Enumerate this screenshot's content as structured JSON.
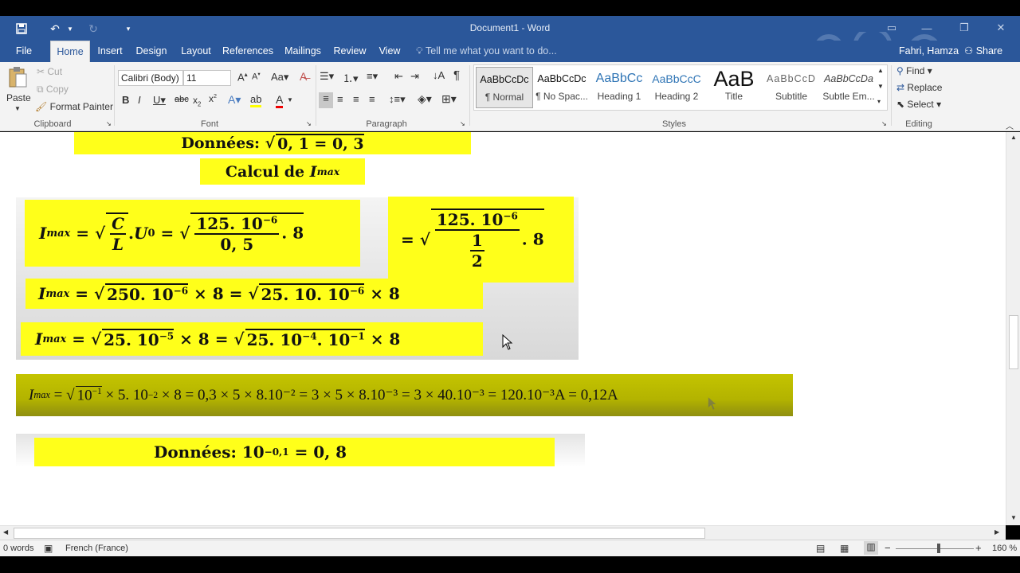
{
  "window": {
    "title": "Document1 - Word"
  },
  "tabs": [
    "File",
    "Home",
    "Insert",
    "Design",
    "Layout",
    "References",
    "Mailings",
    "Review",
    "View"
  ],
  "tell_me": "Tell me what you want to do...",
  "user_name": "Fahri, Hamza",
  "share_label": "Share",
  "clipboard": {
    "paste": "Paste",
    "cut": "Cut",
    "copy": "Copy",
    "format_painter": "Format Painter",
    "label": "Clipboard"
  },
  "font": {
    "name": "Calibri (Body)",
    "size": "11",
    "label": "Font"
  },
  "paragraph": {
    "label": "Paragraph"
  },
  "styles": {
    "label": "Styles",
    "items": [
      {
        "preview": "AaBbCcDc",
        "name": "¶ Normal"
      },
      {
        "preview": "AaBbCcDc",
        "name": "¶ No Spac..."
      },
      {
        "preview": "AaBbCc",
        "name": "Heading 1"
      },
      {
        "preview": "AaBbCcC",
        "name": "Heading 2"
      },
      {
        "preview": "AaB",
        "name": "Title"
      },
      {
        "preview": "AaBbCcD",
        "name": "Subtitle"
      },
      {
        "preview": "AaBbCcDa",
        "name": "Subtle Em..."
      }
    ]
  },
  "editing": {
    "find": "Find",
    "replace": "Replace",
    "select": "Select",
    "label": "Editing"
  },
  "document": {
    "eq1_text": "Données:",
    "eq1_math": "0, 1 = 0, 3",
    "eq2_text": "Calcul de",
    "eq2_var": "I",
    "eq2_sub": "max",
    "eq7_text": "Données:",
    "eq7_math": "= 0, 8",
    "eq6_text": "= 0,3 × 5 × 8.10⁻² = 3 × 5 × 8.10⁻³ = 3 × 40.10⁻³ = 120.10⁻³A = 0,12A"
  },
  "status": {
    "words": "0 words",
    "language": "French (France)",
    "zoom": "160 %"
  }
}
